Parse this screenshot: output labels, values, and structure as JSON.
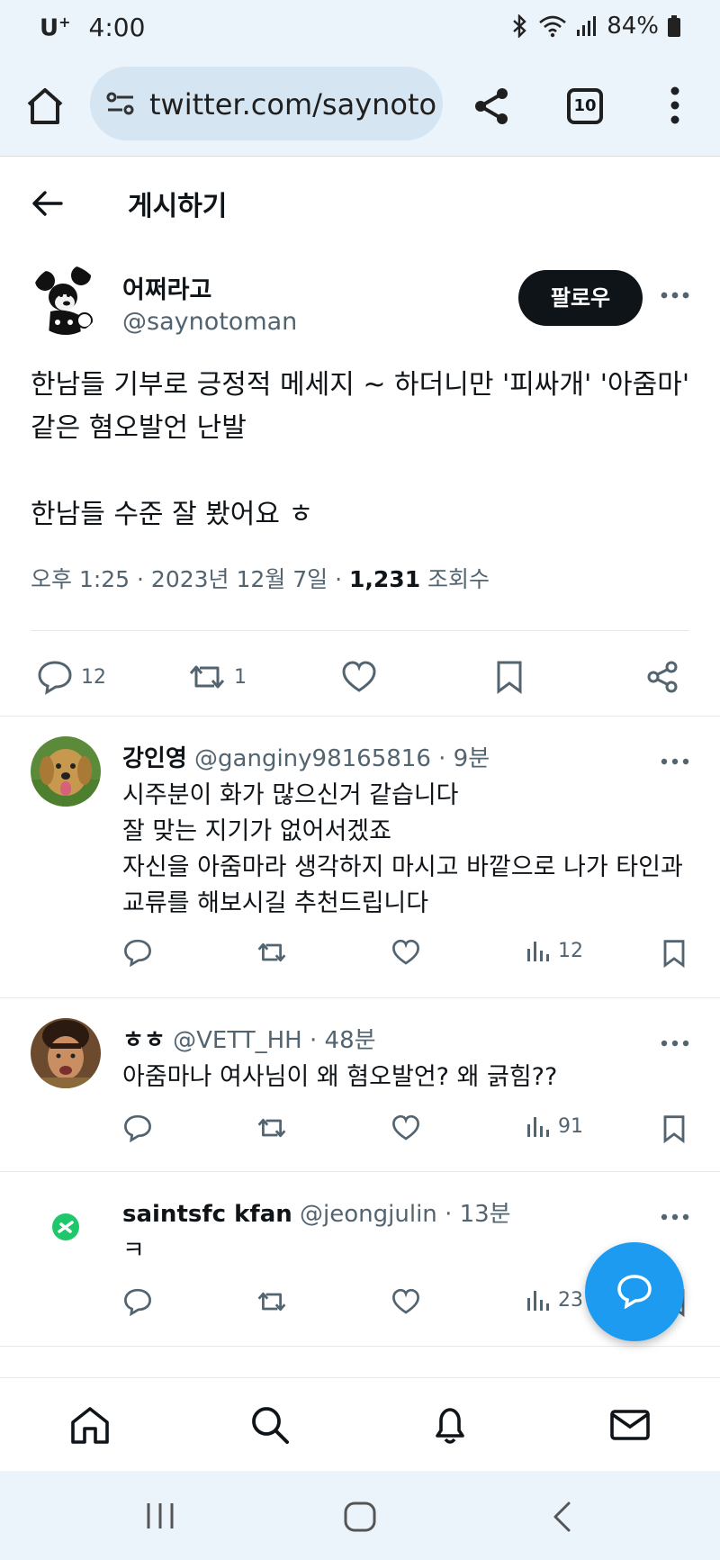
{
  "status_bar": {
    "carrier": "U",
    "carrier_sup": "+",
    "time": "4:00",
    "battery": "84%"
  },
  "browser": {
    "url": "twitter.com/saynotoman",
    "tab_count": "10"
  },
  "header": {
    "title": "게시하기"
  },
  "main_tweet": {
    "name": "어쩌라고",
    "handle": "@saynotoman",
    "follow_label": "팔로우",
    "text": "한남들 기부로 긍정적 메세지 ~ 하더니만 '피싸개' '아줌마' 같은 혐오발언 난발\n\n한남들 수준 잘 봤어요 ㅎ",
    "meta_time": "오후 1:25 · 2023년 12월 7일 · ",
    "views": "1,231",
    "views_label": " 조회수",
    "reply_count": "12",
    "retweet_count": "1"
  },
  "replies": [
    {
      "name": "강인영",
      "handle": "@ganginy98165816",
      "time": "· 9분",
      "text": "시주분이 화가 많으신거 같습니다\n잘 맞는 지기가 없어서겠죠\n자신을 아줌마라 생각하지 마시고 바깥으로 나가 타인과 교류를 해보시길 추천드립니다",
      "views": "12"
    },
    {
      "name": "ㅎㅎ",
      "handle": "@VETT_HH",
      "time": "· 48분",
      "text": "아줌마나 여사님이 왜 혐오발언? 왜 긁힘??",
      "views": "91"
    },
    {
      "name": "saintsfc kfan",
      "handle": "@jeongjulin",
      "time": "· 13분",
      "text": "ㅋ",
      "views": "23"
    }
  ],
  "colors": {
    "accent": "#1d9bf0",
    "text": "#0f1419",
    "muted": "#536471",
    "chrome": "#ebf3fb"
  }
}
